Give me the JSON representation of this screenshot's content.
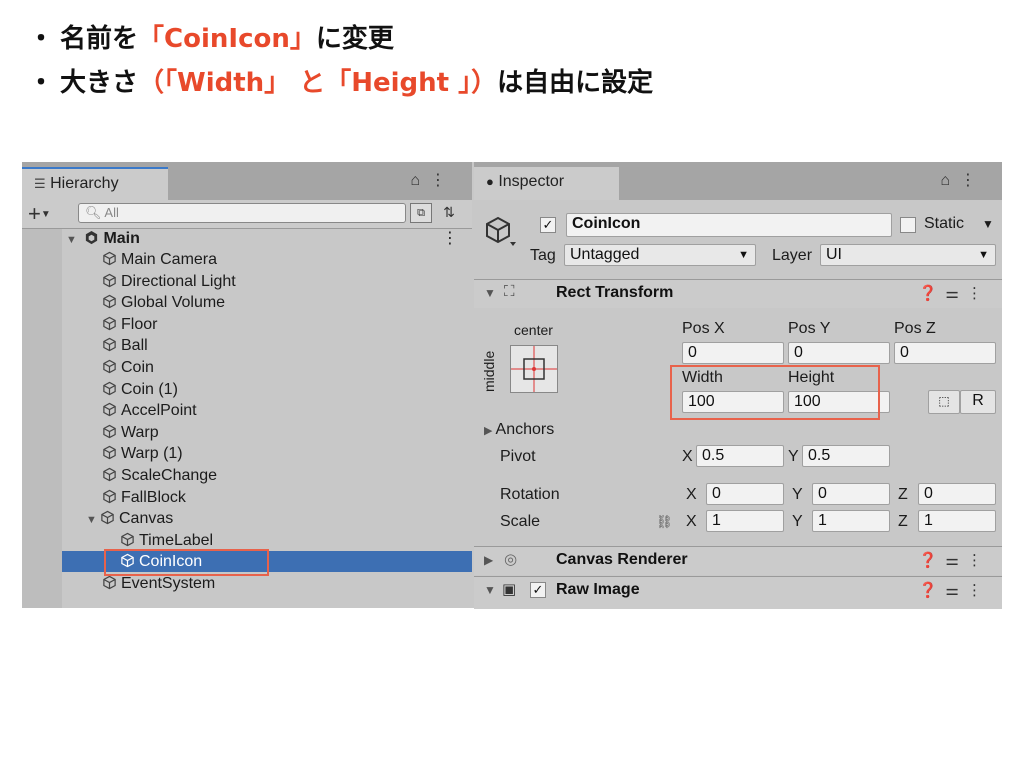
{
  "notes": {
    "line1": {
      "bullet": "・",
      "prefix": "名前を",
      "highlight": "「CoinIcon」",
      "suffix": "に変更"
    },
    "line2": {
      "bullet": "・",
      "prefix": "大きさ",
      "highlight": "（「Width」 と「Height 」）",
      "suffix": "は自由に設定"
    }
  },
  "hierarchy": {
    "tab_label": "Hierarchy",
    "search_placeholder": "All",
    "root": "Main",
    "items": [
      {
        "label": "Main Camera",
        "indent": 1
      },
      {
        "label": "Directional Light",
        "indent": 1
      },
      {
        "label": "Global Volume",
        "indent": 1
      },
      {
        "label": "Floor",
        "indent": 1
      },
      {
        "label": "Ball",
        "indent": 1
      },
      {
        "label": "Coin",
        "indent": 1
      },
      {
        "label": "Coin (1)",
        "indent": 1
      },
      {
        "label": "AccelPoint",
        "indent": 1
      },
      {
        "label": "Warp",
        "indent": 1
      },
      {
        "label": "Warp (1)",
        "indent": 1
      },
      {
        "label": "ScaleChange",
        "indent": 1
      },
      {
        "label": "FallBlock",
        "indent": 1
      },
      {
        "label": "Canvas",
        "indent": 1
      },
      {
        "label": "TimeLabel",
        "indent": 2
      },
      {
        "label": "CoinIcon",
        "indent": 2
      },
      {
        "label": "EventSystem",
        "indent": 1
      }
    ]
  },
  "inspector": {
    "tab_label": "Inspector",
    "object_name": "CoinIcon",
    "static_label": "Static",
    "tag_label": "Tag",
    "tag_value": "Untagged",
    "layer_label": "Layer",
    "layer_value": "UI",
    "rect_transform": {
      "title": "Rect Transform",
      "anchor_h": "center",
      "anchor_v": "middle",
      "pos_x_label": "Pos X",
      "pos_y_label": "Pos Y",
      "pos_z_label": "Pos Z",
      "pos_x": "0",
      "pos_y": "0",
      "pos_z": "0",
      "width_label": "Width",
      "height_label": "Height",
      "width": "100",
      "height": "100",
      "r_button": "R",
      "anchors_label": "Anchors",
      "pivot_label": "Pivot",
      "pivot_x_label": "X",
      "pivot_x": "0.5",
      "pivot_y_label": "Y",
      "pivot_y": "0.5",
      "rotation_label": "Rotation",
      "rot_x": "0",
      "rot_y": "0",
      "rot_z": "0",
      "scale_label": "Scale",
      "scale_x": "1",
      "scale_y": "1",
      "scale_z": "1",
      "x_label": "X",
      "y_label": "Y",
      "z_label": "Z"
    },
    "canvas_renderer": {
      "title": "Canvas Renderer"
    },
    "raw_image": {
      "title": "Raw Image"
    }
  },
  "colors": {
    "highlight": "#e8492b",
    "selection": "#3d6fb3",
    "callout_border": "#e8624b"
  }
}
